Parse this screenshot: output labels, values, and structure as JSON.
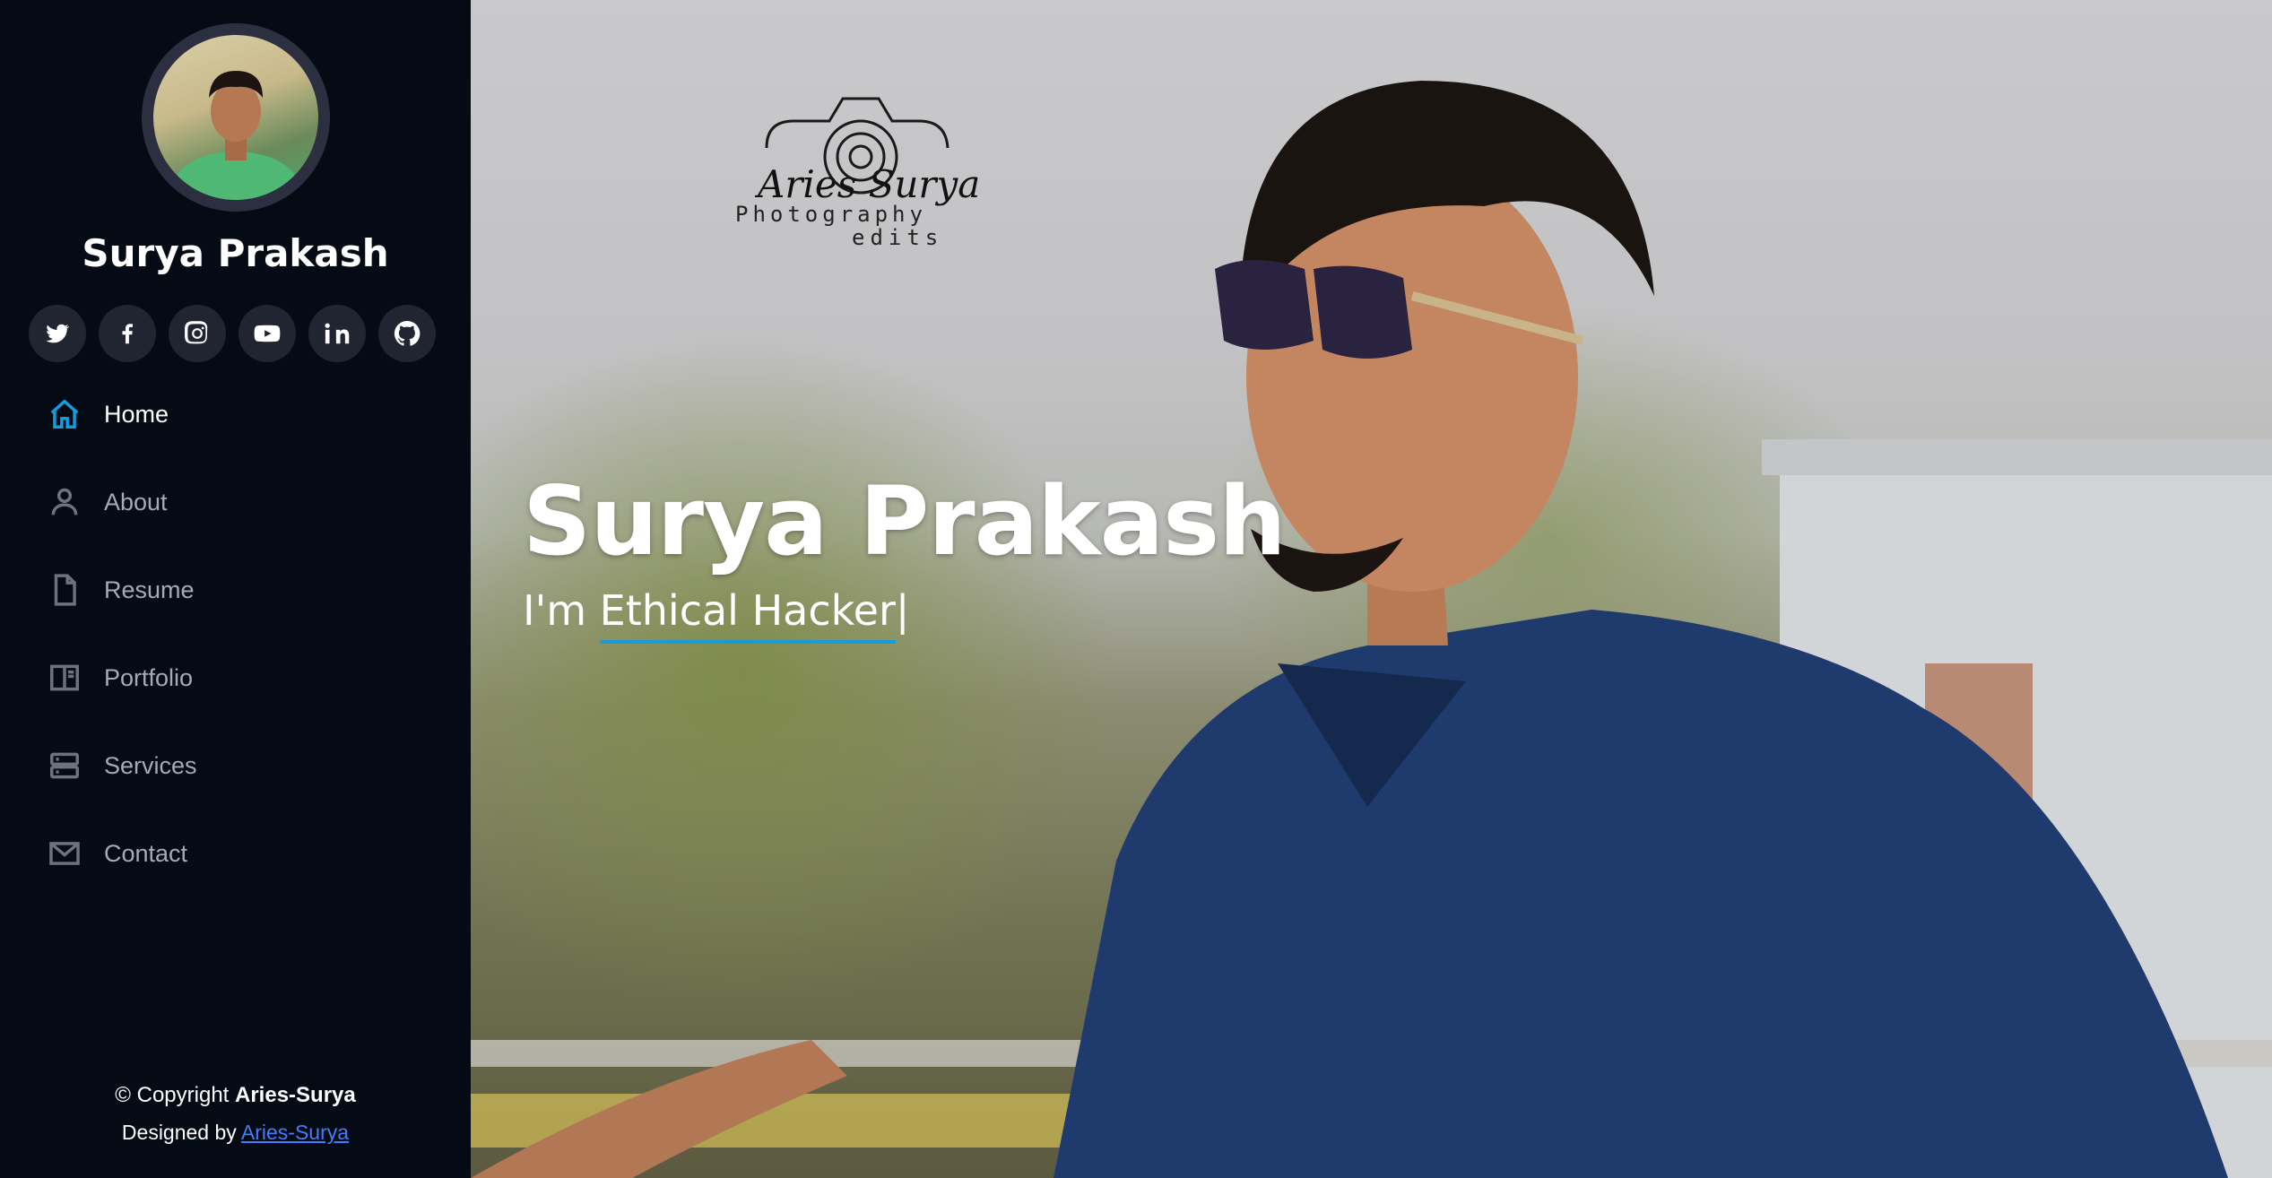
{
  "sidebar": {
    "name": "Surya Prakash",
    "socials": [
      {
        "icon": "twitter-icon"
      },
      {
        "icon": "facebook-icon"
      },
      {
        "icon": "instagram-icon"
      },
      {
        "icon": "youtube-icon"
      },
      {
        "icon": "linkedin-icon"
      },
      {
        "icon": "github-icon"
      }
    ],
    "nav": [
      {
        "label": "Home",
        "icon": "home-icon",
        "active": true
      },
      {
        "label": "About",
        "icon": "person-icon"
      },
      {
        "label": "Resume",
        "icon": "file-icon"
      },
      {
        "label": "Portfolio",
        "icon": "book-icon"
      },
      {
        "label": "Services",
        "icon": "server-icon"
      },
      {
        "label": "Contact",
        "icon": "envelope-icon"
      }
    ],
    "footer": {
      "copyright_prefix": "© Copyright ",
      "copyright_name": "Aries-Surya",
      "designed_prefix": "Designed by ",
      "designed_link": "Aries-Surya"
    }
  },
  "hero": {
    "logo": {
      "line1": "Aries Surya",
      "line2": "Photography",
      "line3": "edits"
    },
    "title": "Surya Prakash",
    "subtitle_prefix": "I'm ",
    "subtitle_typed": "Ethical Hacker",
    "cursor": "|"
  },
  "colors": {
    "accent": "#149ddd",
    "sidebar_bg": "#040b14",
    "social_bg": "#212431"
  }
}
